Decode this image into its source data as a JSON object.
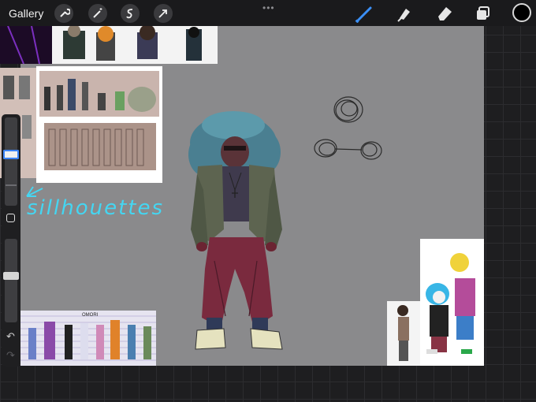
{
  "topbar": {
    "gallery_label": "Gallery",
    "more_dots": "•••",
    "actions": [
      {
        "name": "actions-wrench-icon"
      },
      {
        "name": "adjustments-wand-icon"
      },
      {
        "name": "selection-s-icon"
      },
      {
        "name": "transform-arrow-icon"
      }
    ],
    "tools": [
      {
        "name": "brush-icon",
        "active": true,
        "color": "#3b8ff5"
      },
      {
        "name": "smudge-icon",
        "active": false,
        "color": "#e6e6e6"
      },
      {
        "name": "eraser-icon",
        "active": false,
        "color": "#e6e6e6"
      },
      {
        "name": "layers-icon",
        "active": false,
        "color": "#e6e6e6"
      }
    ],
    "current_color": "#000000"
  },
  "sidebar": {
    "undo_glyph": "↶",
    "redo_glyph": "↷"
  },
  "canvas": {
    "background": "#8a8a8c",
    "annotation_text": "sillhouettes",
    "annotation_color": "#44d6f2"
  },
  "references": {
    "omori_title": "OMORI"
  }
}
